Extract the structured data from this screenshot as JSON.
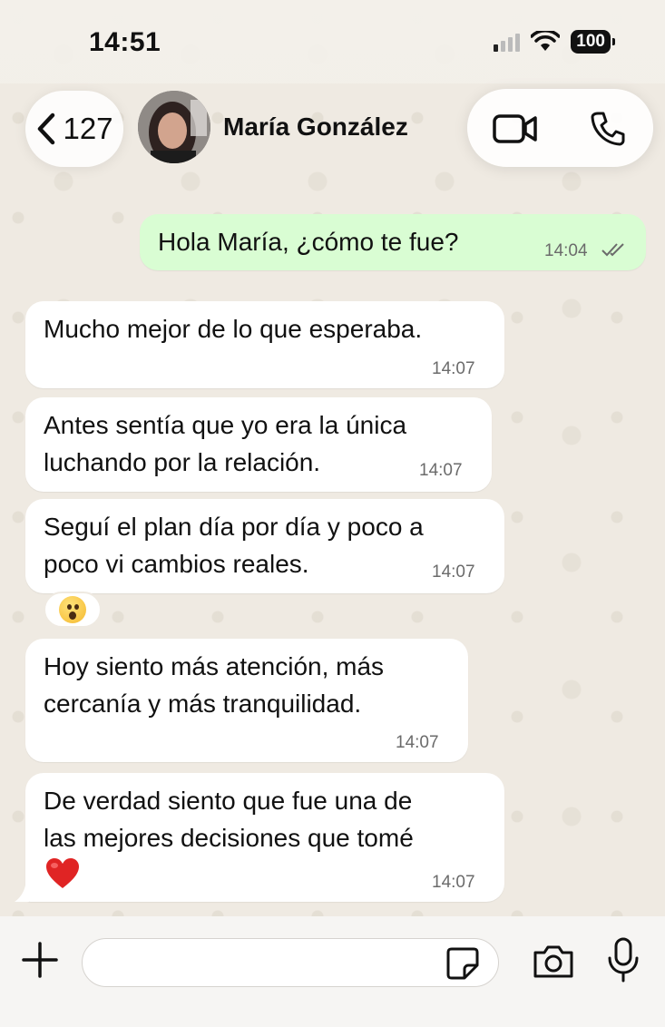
{
  "status_bar": {
    "time": "14:51",
    "battery": "100"
  },
  "header": {
    "back_count": "127",
    "contact_name": "María González"
  },
  "messages": [
    {
      "direction": "out",
      "text": "Hola María, ¿cómo te fue?",
      "time": "14:04"
    },
    {
      "direction": "in",
      "text": "Mucho mejor de lo que esperaba.",
      "time": "14:07"
    },
    {
      "direction": "in",
      "text": "Antes sentía que yo era la única\nluchando por la relación.",
      "time": "14:07"
    },
    {
      "direction": "in",
      "text": "Seguí el plan día por día y poco a\npoco vi cambios reales.",
      "time": "14:07"
    },
    {
      "direction": "in",
      "text": "Hoy siento más atención, más\ncercanía y más tranquilidad.",
      "time": "14:07"
    },
    {
      "direction": "in",
      "text": "De verdad siento que fue una de\nlas mejores decisiones que tomé",
      "time": "14:07"
    }
  ],
  "reaction": {
    "icon": "hushed-face-emoji"
  },
  "input": {
    "placeholder": ""
  },
  "colors": {
    "outgoing_bubble": "#d9fdd3",
    "incoming_bubble": "#ffffff",
    "wallpaper": "#efeae2",
    "read_ticks": "#6b6b6b",
    "heart": "#e02424"
  }
}
